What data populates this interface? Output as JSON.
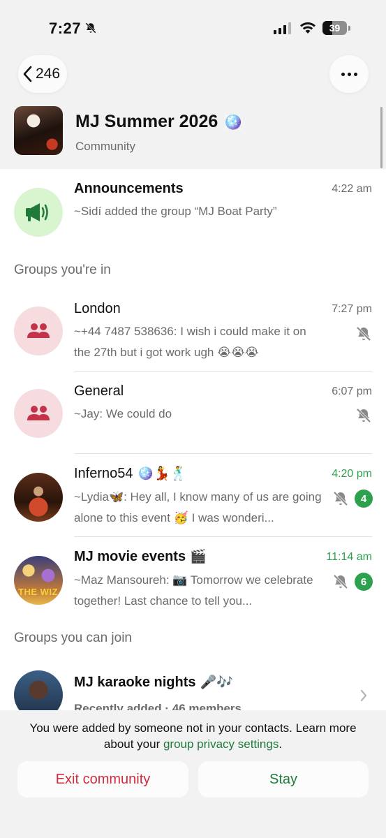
{
  "status_bar": {
    "time": "7:27",
    "battery": "39",
    "battery_fraction": 0.39
  },
  "header": {
    "back_count": "246"
  },
  "community": {
    "name": "MJ Summer 2026",
    "name_emoji": "🪩",
    "subtitle": "Community"
  },
  "announcements": {
    "title": "Announcements",
    "time": "4:22 am",
    "message": "~Sidí added the group “MJ Boat Party”"
  },
  "sections": {
    "joined": "Groups you're in",
    "joinable": "Groups you can join"
  },
  "groups": [
    {
      "title": "London",
      "title_emoji": "",
      "time": "7:27 pm",
      "time_color": "#6b6b6b",
      "sender": "~+44 7487 538636",
      "message": ": I wish i could make it on the 27th but i got work ugh 😭😭😭",
      "muted": true,
      "unread": ""
    },
    {
      "title": "General",
      "title_emoji": "",
      "time": "6:07 pm",
      "time_color": "#6b6b6b",
      "sender": "~Jay",
      "message": ": We could do",
      "muted": true,
      "unread": ""
    },
    {
      "title": "Inferno54",
      "title_emoji": "🪩💃🕺",
      "time": "4:20 pm",
      "time_color": "#2da14d",
      "sender": "~Lydia🦋",
      "message": ": Hey all,  I know many of us are going alone to this event 🥳 I was wonderi...",
      "muted": true,
      "unread": "4"
    },
    {
      "title": "MJ movie events",
      "title_emoji": "🎬",
      "time": "11:14 am",
      "time_color": "#2da14d",
      "sender": "~Maz Mansoureh",
      "message": ": 📷 Tomorrow we celebrate together! Last chance to tell you...",
      "muted": true,
      "unread": "6"
    }
  ],
  "joinable_groups": [
    {
      "title": "MJ karaoke nights",
      "title_emoji": "🎤🎶",
      "info": "Recently added · 46 members"
    }
  ],
  "avatar_texts": {
    "wiz": "THE WIZ"
  },
  "bottom": {
    "notice_text": "You were added by someone not in your contacts. Learn more about your ",
    "notice_link": "group privacy settings",
    "notice_end": ".",
    "exit_label": "Exit community",
    "stay_label": "Stay"
  },
  "colors": {
    "accent_green": "#2da14d",
    "danger_red": "#d02b3c",
    "link_green": "#1f7a3a"
  }
}
